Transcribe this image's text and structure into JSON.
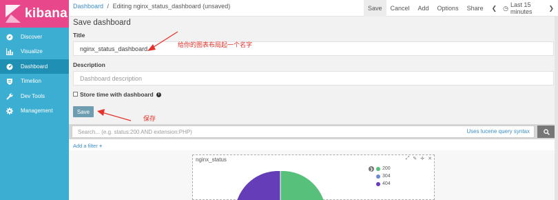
{
  "app": {
    "logo_text": "kibana"
  },
  "sidebar": {
    "items": [
      {
        "label": "Discover",
        "icon": "compass-icon"
      },
      {
        "label": "Visualize",
        "icon": "bar-chart-icon"
      },
      {
        "label": "Dashboard",
        "icon": "dashboard-icon",
        "active": true
      },
      {
        "label": "Timelion",
        "icon": "shield-icon"
      },
      {
        "label": "Dev Tools",
        "icon": "wrench-icon"
      },
      {
        "label": "Management",
        "icon": "gear-icon"
      }
    ]
  },
  "breadcrumb": {
    "root": "Dashboard",
    "separator": "/",
    "current": "Editing nginx_status_dashboard (unsaved)"
  },
  "topmenu": {
    "save": "Save",
    "cancel": "Cancel",
    "add": "Add",
    "options": "Options",
    "share": "Share",
    "time": "Last 15 minutes",
    "prev_icon": "chevron-left-icon",
    "next_icon": "chevron-right-icon"
  },
  "save_panel": {
    "heading": "Save dashboard",
    "title_label": "Title",
    "title_value": "nginx_status_dashboard",
    "description_label": "Description",
    "description_placeholder": "Dashboard description",
    "store_time_label": "Store time with dashboard",
    "save_button": "Save"
  },
  "annotations": {
    "title_note": "给你的图表布局起一个名字",
    "save_note": "保存"
  },
  "query": {
    "placeholder": "Search... (e.g. status:200 AND extension:PHP)",
    "lucene_link": "Uses lucene query syntax",
    "add_filter": "Add a filter"
  },
  "visualization": {
    "title": "nginx_status",
    "legend": [
      {
        "label": "200",
        "color": "#57c17b"
      },
      {
        "label": "304",
        "color": "#6f87d8"
      },
      {
        "label": "404",
        "color": "#663db8"
      }
    ]
  },
  "colors": {
    "accent": "#3caed2",
    "logo": "#e8488b",
    "annotation": "#e6322a"
  }
}
